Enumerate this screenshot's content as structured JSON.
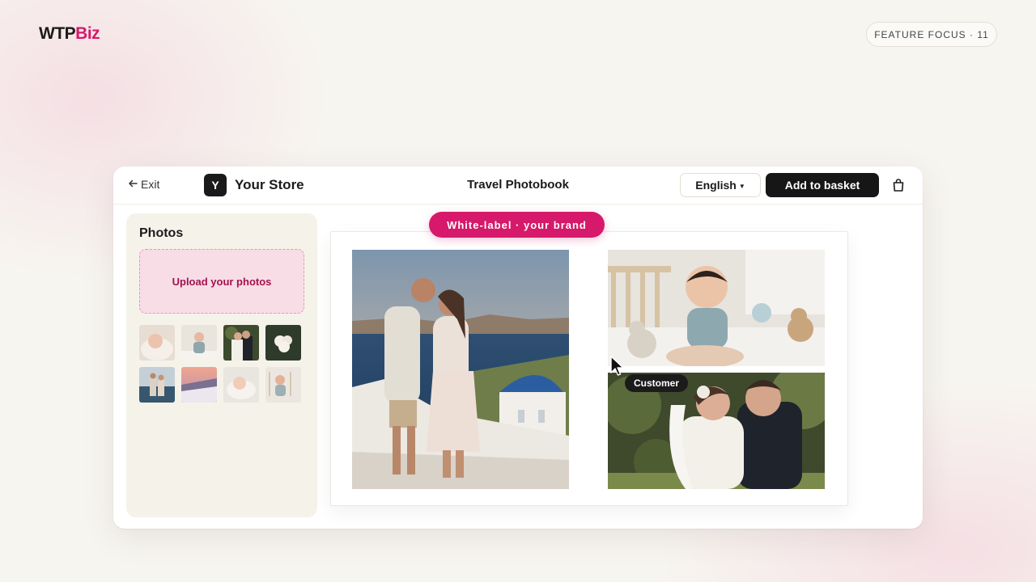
{
  "brand": {
    "part1": "WTP",
    "part2": "Biz"
  },
  "feature_focus": "FEATURE FOCUS · 11",
  "editor": {
    "exit_label": "Exit",
    "store_initial": "Y",
    "store_name": "Your Store",
    "document_title": "Travel Photobook",
    "language": "English",
    "add_to_basket": "Add to basket",
    "basket_icon": "shopping-bag-icon"
  },
  "sidebar": {
    "title": "Photos",
    "upload_label": "Upload your photos",
    "thumbnails": [
      "baby-sleeping",
      "baby-sitting",
      "wedding-couple",
      "flower-bouquet",
      "travel-couple",
      "sunset-village",
      "baby-sleeping-2",
      "baby-crib"
    ]
  },
  "canvas": {
    "badge": "White-label · your brand",
    "customer_tag": "Customer",
    "photos": [
      "travel-couple-santorini",
      "laughing-baby",
      "wedding-couple-embrace"
    ]
  },
  "colors": {
    "accent": "#d6196a",
    "dark": "#161616",
    "panel": "#f5f2ea"
  }
}
